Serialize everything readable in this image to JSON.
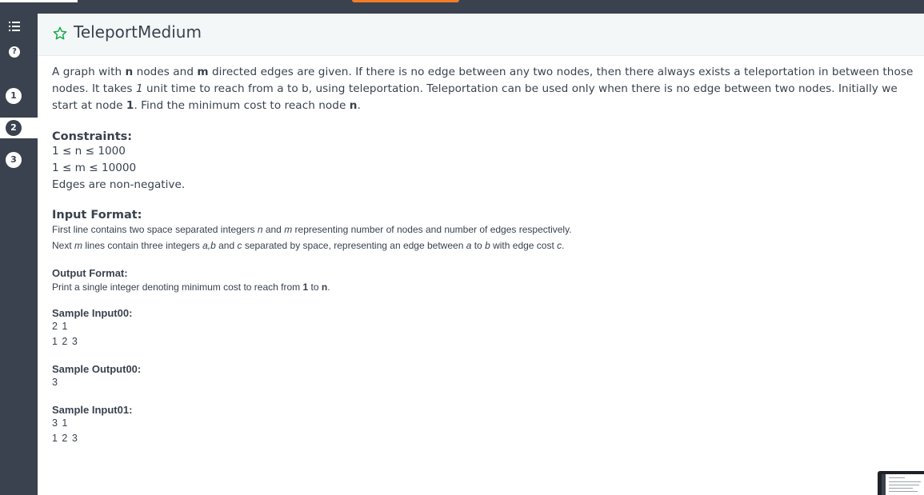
{
  "problem": {
    "title": "TeleportMedium"
  },
  "sidebar": {
    "questions": [
      {
        "label": "1",
        "active": false
      },
      {
        "label": "2",
        "active": true
      },
      {
        "label": "3",
        "active": false
      }
    ],
    "help_label": "?"
  },
  "description": {
    "p1_a": "A graph with ",
    "p1_n": "n",
    "p1_b": " nodes and ",
    "p1_m": "m",
    "p1_c": " directed edges are given. If there is no edge between any two nodes, then there always exists a teleportation in between those nodes. It takes ",
    "p1_1": "1",
    "p1_d": " unit time to reach from a to b, using teleportation. Teleportation can be used only when there is no edge between two nodes. Initially we start at node ",
    "p1_start": "1",
    "p1_e": ". Find the minimum cost to reach node ",
    "p1_target": "n",
    "p1_f": "."
  },
  "constraints": {
    "title": "Constraints:",
    "lines": [
      "1  ≤ n ≤ 1000",
      "1 ≤ m ≤ 10000",
      "Edges are non-negative."
    ]
  },
  "input_format": {
    "title": "Input Format:",
    "l1_a": "First line contains two space separated integers ",
    "l1_n": "n",
    "l1_b": " and ",
    "l1_m": "m",
    "l1_c": " representing number of nodes and number of edges respectively.",
    "l2_a": "Next ",
    "l2_m": "m",
    "l2_b": " lines contain three integers ",
    "l2_abc": "a,b",
    "l2_c": " and ",
    "l2_cv": "c",
    "l2_d": " separated by space, representing an edge between ",
    "l2_av": "a",
    "l2_e": " to ",
    "l2_bv": "b",
    "l2_f": " with edge cost ",
    "l2_cc": "c",
    "l2_g": "."
  },
  "output_format": {
    "title": "Output Format:",
    "a": "Print a single integer denoting minimum cost to reach from ",
    "one": "1",
    "b": " to ",
    "n": "n",
    "c": "."
  },
  "samples": [
    {
      "title": "Sample Input00:",
      "lines": [
        "2 1",
        "1 2 3"
      ]
    },
    {
      "title": "Sample Output00:",
      "lines": [
        "3"
      ]
    },
    {
      "title": "Sample Input01:",
      "lines": [
        "3 1",
        "1 2 3"
      ]
    }
  ],
  "colors": {
    "sidebar": "#39424e",
    "accent_orange": "#f27d27",
    "star_green": "#1ba94c",
    "header_bg": "#f3f7f7"
  },
  "icons": [
    "list-icon",
    "help-icon",
    "star-icon"
  ]
}
